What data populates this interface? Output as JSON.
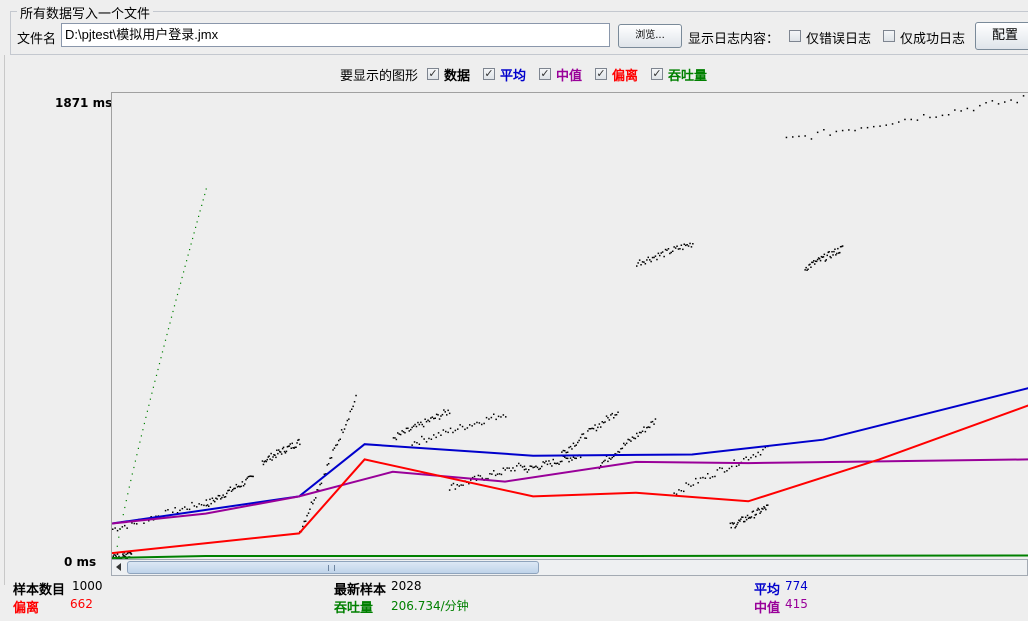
{
  "panel": {
    "group_title": "所有数据写入一个文件",
    "filename_label": "文件名",
    "filename_value": "D:\\pjtest\\模拟用户登录.jmx",
    "browse_label": "浏览...",
    "log_label": "显示日志内容：",
    "errors_only_label": "仅错误日志",
    "success_only_label": "仅成功日志",
    "configure_label": "配置"
  },
  "graph_options": {
    "label": "要显示的图形",
    "items": [
      {
        "label": "数据",
        "checked": true,
        "color": "#000000"
      },
      {
        "label": "平均",
        "checked": true,
        "color": "#0000cc"
      },
      {
        "label": "中值",
        "checked": true,
        "color": "#990099"
      },
      {
        "label": "偏离",
        "checked": true,
        "color": "#ff0000"
      },
      {
        "label": "吞吐量",
        "checked": true,
        "color": "#008000"
      }
    ]
  },
  "chart_data": {
    "type": "line",
    "ylim": [
      0,
      1871
    ],
    "y_top_label": "1871 ms",
    "y_bottom_label": "0 ms",
    "series": [
      {
        "name": "平均",
        "color": "#0000cc",
        "x": [
          0,
          200,
          270,
          450,
          620,
          760,
          980
        ],
        "values": [
          140,
          250,
          462,
          415,
          420,
          480,
          690
        ]
      },
      {
        "name": "中值",
        "color": "#990099",
        "x": [
          0,
          100,
          200,
          300,
          420,
          560,
          680,
          980
        ],
        "values": [
          140,
          180,
          250,
          350,
          310,
          390,
          385,
          400
        ]
      },
      {
        "name": "偏离",
        "color": "#ff0000",
        "x": [
          0,
          100,
          200,
          270,
          450,
          560,
          680,
          820,
          980
        ],
        "values": [
          20,
          60,
          100,
          400,
          250,
          265,
          230,
          400,
          620
        ]
      },
      {
        "name": "吞吐量",
        "color": "#008000",
        "x": [
          0,
          100,
          500,
          980
        ],
        "values": [
          0,
          8,
          8,
          10
        ]
      }
    ]
  },
  "stats": {
    "samples_label": "样本数目",
    "samples_value": "1000",
    "deviation_label": "偏离",
    "deviation_value": "662",
    "latest_label": "最新样本",
    "latest_value": "2028",
    "throughput_label": "吞吐量",
    "throughput_value": "206.734/分钟",
    "average_label": "平均",
    "average_value": "774",
    "median_label": "中值",
    "median_value": "415"
  }
}
